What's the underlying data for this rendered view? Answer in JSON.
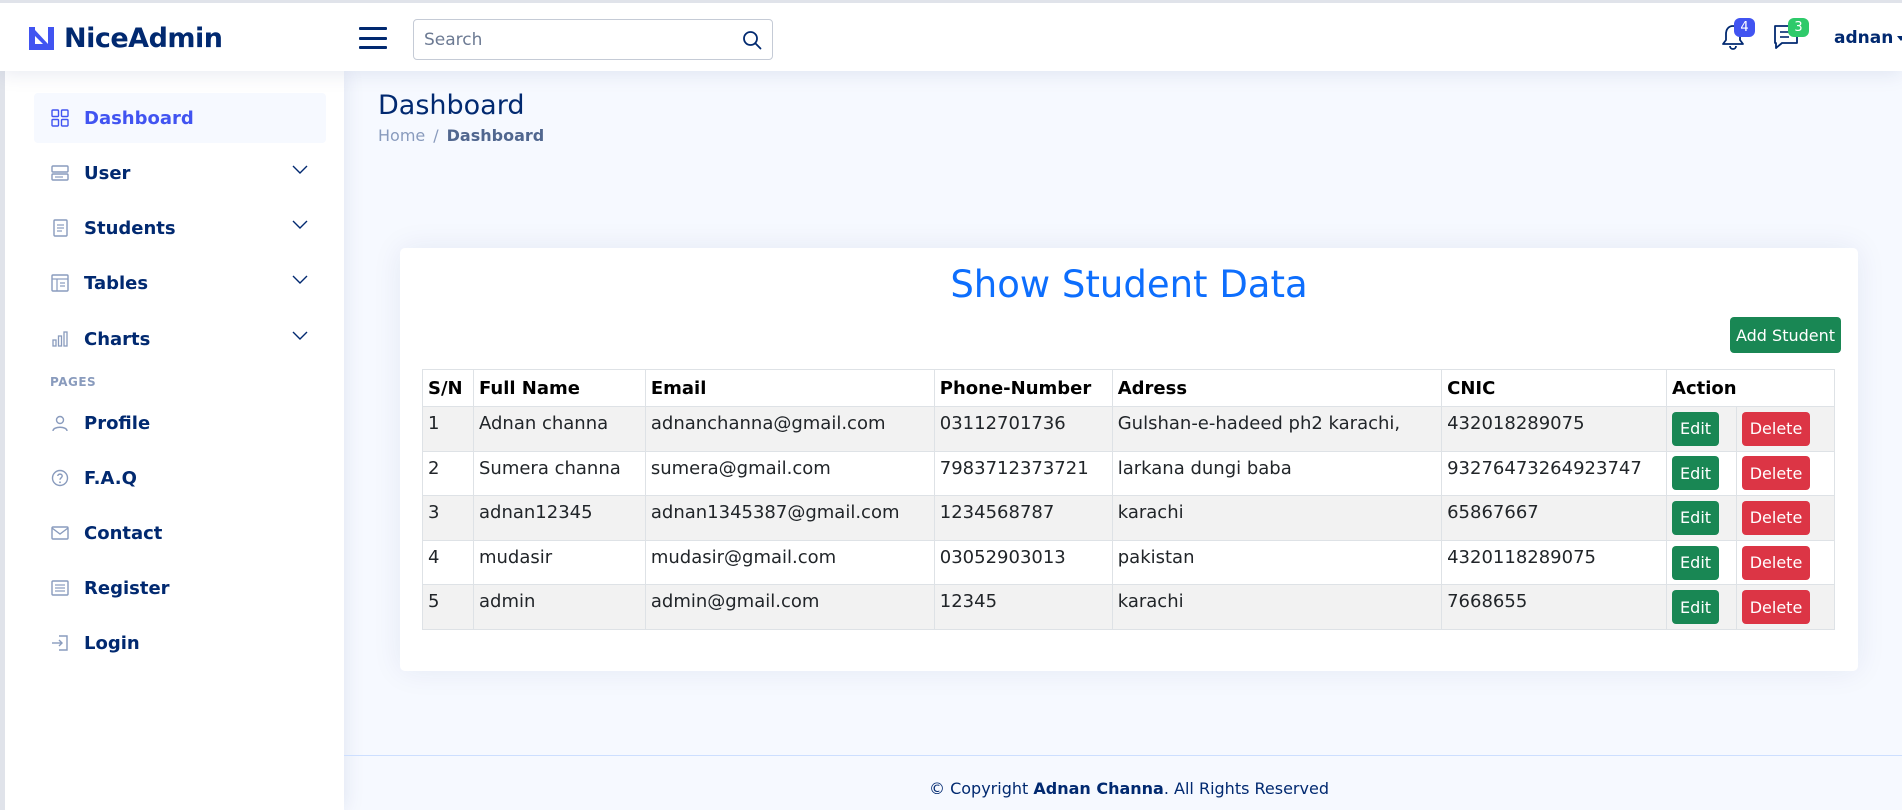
{
  "app": {
    "name": "NiceAdmin"
  },
  "header": {
    "search_placeholder": "Search",
    "notifications_count": "4",
    "messages_count": "3",
    "user_name": "adnan"
  },
  "sidebar": {
    "items": [
      {
        "label": "Dashboard",
        "icon": "grid-icon",
        "active": true
      },
      {
        "label": "User",
        "icon": "menu-button-icon",
        "expandable": true
      },
      {
        "label": "Students",
        "icon": "journal-text-icon",
        "expandable": true
      },
      {
        "label": "Tables",
        "icon": "layout-text-window-icon",
        "expandable": true
      },
      {
        "label": "Charts",
        "icon": "bar-chart-icon",
        "expandable": true
      }
    ],
    "pages_heading": "PAGES",
    "pages": [
      {
        "label": "Profile",
        "icon": "person-icon"
      },
      {
        "label": "F.A.Q",
        "icon": "question-circle-icon"
      },
      {
        "label": "Contact",
        "icon": "envelope-icon"
      },
      {
        "label": "Register",
        "icon": "card-list-icon"
      },
      {
        "label": "Login",
        "icon": "box-arrow-in-right-icon"
      }
    ]
  },
  "page": {
    "title": "Dashboard",
    "breadcrumb": [
      "Home",
      "Dashboard"
    ],
    "separator": "/"
  },
  "card": {
    "title": "Show Student Data",
    "add_button": "Add Student",
    "columns": [
      "S/N",
      "Full Name",
      "Email",
      "Phone-Number",
      "Adress",
      "CNIC",
      "Action"
    ],
    "rows": [
      [
        "1",
        "Adnan channa",
        "adnanchanna@gmail.com",
        "03112701736",
        "Gulshan-e-hadeed ph2 karachi,",
        "432018289075"
      ],
      [
        "2",
        "Sumera channa",
        "sumera@gmail.com",
        "7983712373721",
        "larkana dungi baba",
        "93276473264923747"
      ],
      [
        "3",
        "adnan12345",
        "adnan1345387@gmail.com",
        "1234568787",
        "karachi",
        "65867667"
      ],
      [
        "4",
        "mudasir",
        "mudasir@gmail.com",
        "03052903013",
        "pakistan",
        "4320118289075"
      ],
      [
        "5",
        "admin",
        "admin@gmail.com",
        "12345",
        "karachi",
        "7668655"
      ]
    ],
    "edit_label": "Edit",
    "delete_label": "Delete"
  },
  "footer": {
    "prefix": "© Copyright ",
    "owner": "Adnan Channa",
    "suffix": ". All Rights Reserved"
  },
  "colors": {
    "brand": "#012970",
    "accent": "#4154f1",
    "title_blue": "#0d6efd",
    "success": "#198754",
    "danger": "#dc3545"
  }
}
